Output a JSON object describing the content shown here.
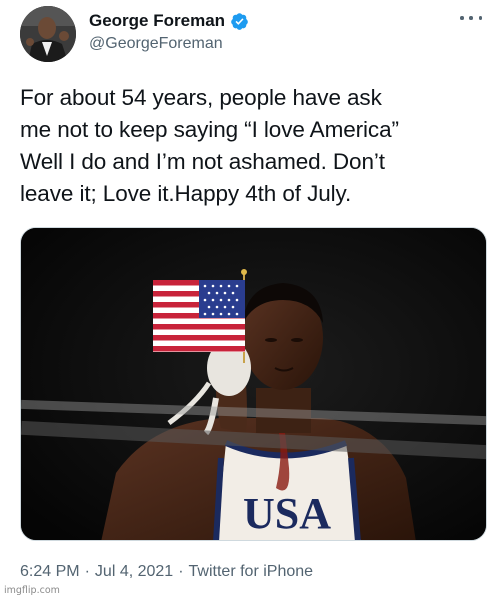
{
  "author": {
    "display_name": "George Foreman",
    "handle": "@GeorgeForeman",
    "avatar_icon": "profile-photo",
    "verified_icon": "verified-badge-icon",
    "verified_color": "#1d9bf0"
  },
  "tweet": {
    "text": "For about 54 years, people have ask\nme not to keep saying “I love America”\nWell I do and I’m not ashamed. Don’t\nleave it; Love it.Happy 4th of July.",
    "media_icon": "photo-boxer-waving-flag",
    "jersey_text": "USA"
  },
  "meta": {
    "time": "6:24 PM",
    "separator": "·",
    "date": "Jul 4, 2021",
    "source": "Twitter for iPhone"
  },
  "more_icon": "more-options-icon",
  "watermark": "imgflip.com"
}
